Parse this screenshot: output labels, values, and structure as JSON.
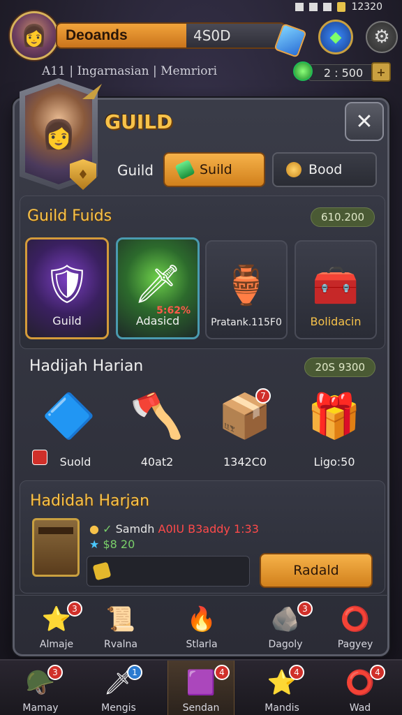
{
  "status_bar": {
    "time": "12320"
  },
  "top_bar": {
    "player_name": "Deoands",
    "score": "4S0D",
    "subtitle": "A11 | Ingarnasian | Memriori",
    "currency_value": "2 : 500"
  },
  "panel": {
    "title": "GUILD",
    "tab_row_label": "Guild",
    "tabs": [
      {
        "label": "Suild",
        "active": true
      },
      {
        "label": "Bood",
        "active": false
      }
    ]
  },
  "guild_funds": {
    "title": "Guild Fuids",
    "badge": "610.200",
    "items": [
      {
        "label": "Guild",
        "icon": "armor-icon",
        "overlay": ""
      },
      {
        "label": "Adasicd",
        "icon": "spear-icon",
        "overlay": "5:62%"
      },
      {
        "label": "Pratank.115F0",
        "icon": "potion-icon",
        "overlay": ""
      },
      {
        "label": "Bolidacin",
        "icon": "chest-icon",
        "overlay": ""
      }
    ]
  },
  "daily_rewards": {
    "title": "Hadijah Harian",
    "badge": "20S 9300",
    "items": [
      {
        "label": "Suold",
        "icon": "shield-gem-icon",
        "badge": ""
      },
      {
        "label": "40at2",
        "icon": "crystal-axe-icon",
        "badge": ""
      },
      {
        "label": "1342C0",
        "icon": "blue-box-icon",
        "badge": "7"
      },
      {
        "label": "Ligo:50",
        "icon": "gold-box-icon",
        "badge": ""
      }
    ]
  },
  "daily_claim": {
    "title": "Hadidah Harjan",
    "line1_label": "Samdh",
    "line1_value": "A0IU B3addy 1:33",
    "line2_label": "$8 20",
    "claim_button": "Radald"
  },
  "panel_nav": [
    {
      "label": "Almaje",
      "icon": "star-rock-icon",
      "badge": "3"
    },
    {
      "label": "Rvalna",
      "icon": "scroll-icon",
      "badge": ""
    },
    {
      "label": "Stlarla",
      "icon": "crest-icon",
      "badge": ""
    },
    {
      "label": "Dagoly",
      "icon": "rock-icon",
      "badge": "3"
    },
    {
      "label": "Pagyey",
      "icon": "ring-icon",
      "badge": ""
    }
  ],
  "bottom_nav": [
    {
      "label": "Mamay",
      "icon": "helmet-icon",
      "badge": "3"
    },
    {
      "label": "Mengis",
      "icon": "sword-icon",
      "badge": "1"
    },
    {
      "label": "Sendan",
      "icon": "cube-icon",
      "badge": "4"
    },
    {
      "label": "Mandis",
      "icon": "star-icon",
      "badge": "4"
    },
    {
      "label": "Wad",
      "icon": "ring-icon",
      "badge": "4"
    }
  ]
}
